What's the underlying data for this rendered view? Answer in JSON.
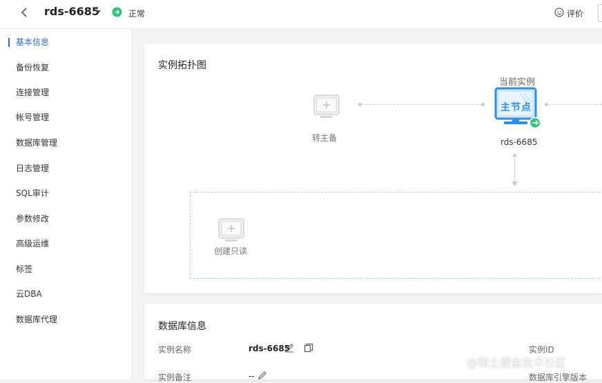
{
  "header": {
    "instance_name": "rds-6685",
    "status_text": "正常",
    "rate_label": "评价"
  },
  "sidebar": {
    "items": [
      {
        "label": "基本信息",
        "active": true
      },
      {
        "label": "备份恢复"
      },
      {
        "label": "连接管理"
      },
      {
        "label": "帐号管理"
      },
      {
        "label": "数据库管理"
      },
      {
        "label": "日志管理"
      },
      {
        "label": "SQL审计"
      },
      {
        "label": "参数修改"
      },
      {
        "label": "高级运维"
      },
      {
        "label": "标签"
      },
      {
        "label": "云DBA"
      },
      {
        "label": "数据库代理"
      }
    ]
  },
  "topology": {
    "title": "实例拓扑图",
    "standby_label": "转主备",
    "current_instance_label": "当前实例",
    "primary_badge": "主节点",
    "primary_name": "rds-6685",
    "readonly_label": "创建只读"
  },
  "db_info": {
    "title": "数据库信息",
    "rows": [
      {
        "label": "实例名称",
        "value": "rds-6685",
        "right_label": "实例ID"
      },
      {
        "label": "实例备注",
        "value": "--",
        "right_label": "数据库引擎版本"
      }
    ]
  },
  "watermark": "@稀土掘金技术社区",
  "colors": {
    "accent": "#2c6bd6",
    "status_green": "#2fc17a",
    "monitor_blue": "#2b8fe6"
  }
}
